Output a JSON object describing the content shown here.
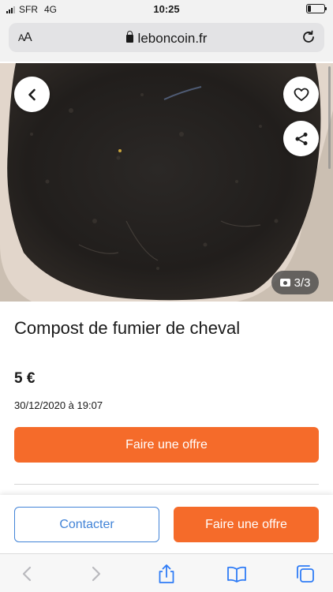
{
  "status_bar": {
    "carrier": "SFR",
    "network": "4G",
    "time": "10:25",
    "battery_level": 0.2
  },
  "browser": {
    "text_size_label": "AA",
    "url": "leboncoin.fr"
  },
  "listing": {
    "photo_counter": "3/3",
    "title": "Compost de fumier de cheval",
    "price": "5 €",
    "date": "30/12/2020 à 19:07",
    "offer_button": "Faire une offre"
  },
  "bottom_actions": {
    "contact_button": "Contacter",
    "offer_button": "Faire une offre"
  },
  "colors": {
    "accent_orange": "#f56b2a",
    "contact_blue": "#4183d7"
  },
  "icons": [
    "signal-icon",
    "battery-icon",
    "lock-icon",
    "reload-icon",
    "back-arrow-icon",
    "heart-icon",
    "share-icon",
    "camera-icon",
    "safari-back-icon",
    "safari-forward-icon",
    "safari-share-icon",
    "bookmarks-icon",
    "tabs-icon"
  ]
}
